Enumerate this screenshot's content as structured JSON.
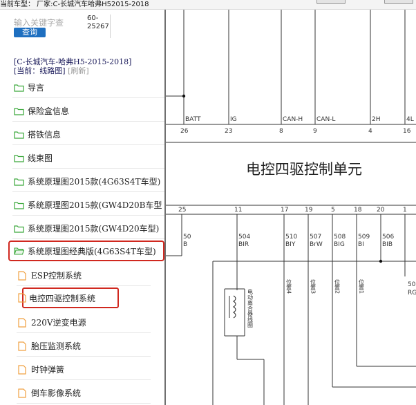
{
  "window": {
    "title": "当前车型： 厂家:C-长城汽车哈弗H52015-2018"
  },
  "search": {
    "placeholder": "输入关键字查",
    "button_label": "查询",
    "code_line1": "60-",
    "code_line2": "25267"
  },
  "car": {
    "info": "[C-长城汽车-哈弗H5-2015-2018]",
    "current": "[当前：线路图]",
    "refresh": "[刷新]"
  },
  "tree": {
    "folders": [
      {
        "label": "导言"
      },
      {
        "label": "保险盒信息"
      },
      {
        "label": "搭铁信息"
      },
      {
        "label": "线束图"
      },
      {
        "label": "系统原理图2015款(4G63S4T车型)"
      },
      {
        "label": "系统原理图2015款(GW4D20B车型"
      },
      {
        "label": "系统原理图2015款(GW4D20车型)"
      },
      {
        "label": "系统原理图经典版(4G63S4T车型)"
      }
    ],
    "leaves": [
      {
        "label": "ESP控制系统"
      },
      {
        "label": "电控四驱控制系统"
      },
      {
        "label": "220V逆变电源"
      },
      {
        "label": "胎压监测系统"
      },
      {
        "label": "时钟弹簧"
      },
      {
        "label": "倒车影像系统"
      }
    ]
  },
  "diagram": {
    "title": "电控四驱控制单元",
    "top_pins": [
      "26",
      "23",
      "8",
      "9",
      "4",
      "16"
    ],
    "top_signals": [
      "BATT",
      "IG",
      "CAN-H",
      "CAN-L",
      "2H",
      "4L"
    ],
    "bottom_pins": [
      "25",
      "11",
      "17",
      "19",
      "5",
      "18",
      "20",
      "1"
    ],
    "wire_codes": [
      "50",
      "504",
      "510",
      "507",
      "508",
      "509",
      "506",
      "50"
    ],
    "wire_colors": [
      "B",
      "BIR",
      "BIY",
      "BrW",
      "BIG",
      "BI",
      "BIB",
      "RG"
    ],
    "coil_label": "电动离合器线圈",
    "positions": [
      "位置4",
      "位置3",
      "位置2",
      "位置1"
    ]
  },
  "colors": {
    "accent": "#1e6fc0",
    "highlight_border": "#d0281f",
    "folder_green": "#3aa83a",
    "doc_orange": "#f0a040"
  }
}
